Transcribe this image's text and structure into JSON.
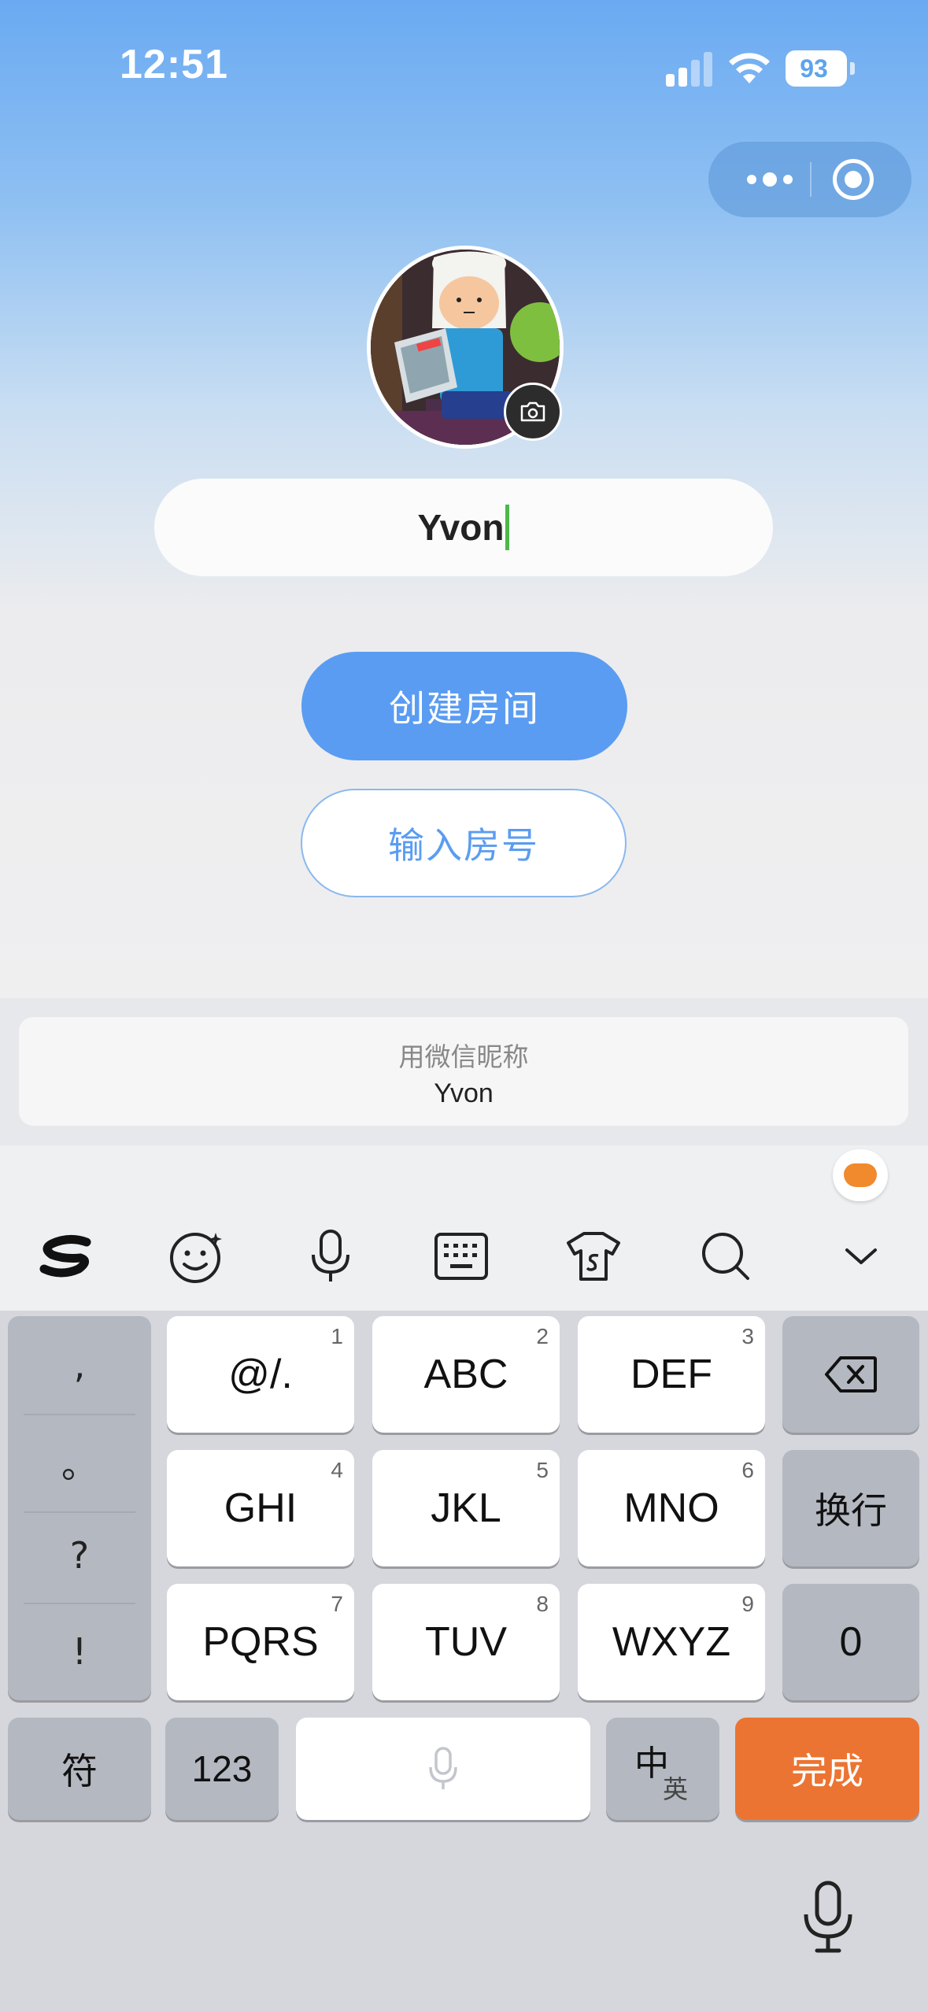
{
  "status_bar": {
    "time": "12:51",
    "battery": "93"
  },
  "profile": {
    "name_value": "Yvon"
  },
  "buttons": {
    "create_room": "创建房间",
    "enter_room_no": "输入房号"
  },
  "suggestion": {
    "label": "用微信昵称",
    "nickname": "Yvon"
  },
  "keyboard": {
    "toolbar_icons": [
      "sogou-logo-icon",
      "emoji-icon",
      "voice-icon",
      "keyboard-icon",
      "skin-icon",
      "search-icon",
      "collapse-icon"
    ],
    "punct": [
      ",",
      "。",
      "?",
      "!"
    ],
    "row1": [
      {
        "label": "@/.",
        "num": "1"
      },
      {
        "label": "ABC",
        "num": "2"
      },
      {
        "label": "DEF",
        "num": "3"
      }
    ],
    "row2": [
      {
        "label": "GHI",
        "num": "4"
      },
      {
        "label": "JKL",
        "num": "5"
      },
      {
        "label": "MNO",
        "num": "6"
      }
    ],
    "row3": [
      {
        "label": "PQRS",
        "num": "7"
      },
      {
        "label": "TUV",
        "num": "8"
      },
      {
        "label": "WXYZ",
        "num": "9"
      }
    ],
    "newline": "换行",
    "zero": "0",
    "symbols": "符",
    "numbers": "123",
    "lang_zh": "中",
    "lang_en": "英",
    "done": "完成"
  },
  "colors": {
    "primary": "#5a9cf2",
    "done_key": "#ec7432",
    "caret": "#4cb84a"
  }
}
